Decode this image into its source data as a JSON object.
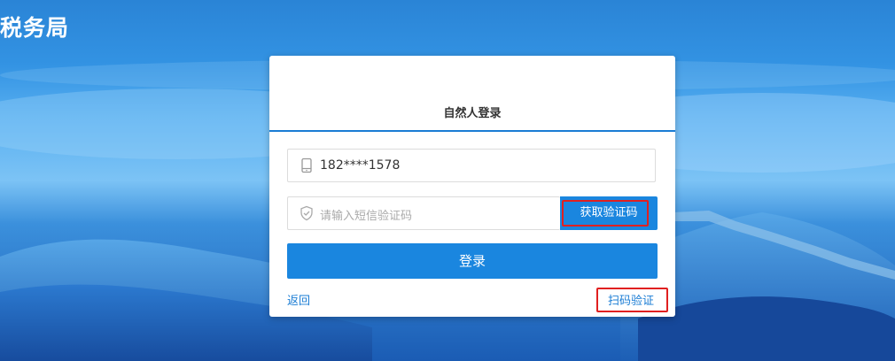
{
  "site": {
    "title": "税务局"
  },
  "login": {
    "title": "自然人登录",
    "phone_value": "182****1578",
    "sms_placeholder": "请输入短信验证码",
    "get_code_label": "获取验证码",
    "login_label": "登录",
    "back_label": "返回",
    "scan_label": "扫码验证"
  },
  "icons": {
    "phone": "phone-icon",
    "shield": "shield-check-icon"
  },
  "colors": {
    "accent": "#1a86df",
    "link": "#1a7cd4",
    "highlight": "#e02020",
    "background": "#2f8ee0"
  }
}
